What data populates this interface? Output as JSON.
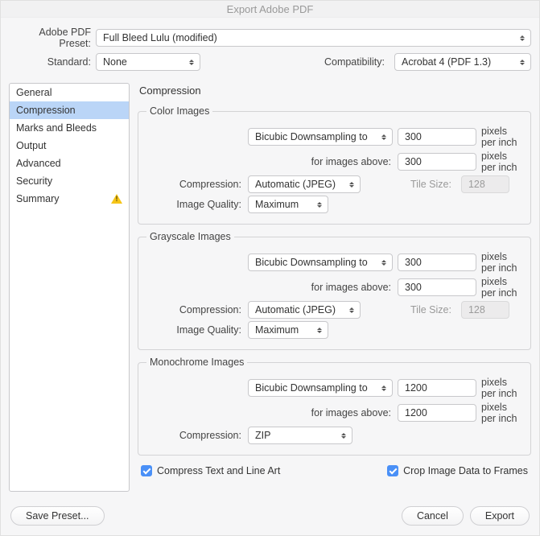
{
  "title": "Export Adobe PDF",
  "header": {
    "preset_label": "Adobe PDF Preset:",
    "preset_value": "Full Bleed Lulu (modified)",
    "standard_label": "Standard:",
    "standard_value": "None",
    "compat_label": "Compatibility:",
    "compat_value": "Acrobat 4 (PDF 1.3)"
  },
  "sidebar": {
    "items": [
      {
        "label": "General"
      },
      {
        "label": "Compression",
        "selected": true
      },
      {
        "label": "Marks and Bleeds"
      },
      {
        "label": "Output"
      },
      {
        "label": "Advanced"
      },
      {
        "label": "Security"
      },
      {
        "label": "Summary",
        "warn": true
      }
    ]
  },
  "panel": {
    "title": "Compression",
    "color": {
      "legend": "Color Images",
      "method": "Bicubic Downsampling to",
      "ppi": "300",
      "unit": "pixels per inch",
      "above_label": "for images above:",
      "above_ppi": "300",
      "compression_label": "Compression:",
      "compression_value": "Automatic (JPEG)",
      "tile_label": "Tile Size:",
      "tile_value": "128",
      "quality_label": "Image Quality:",
      "quality_value": "Maximum"
    },
    "gray": {
      "legend": "Grayscale Images",
      "method": "Bicubic Downsampling to",
      "ppi": "300",
      "unit": "pixels per inch",
      "above_label": "for images above:",
      "above_ppi": "300",
      "compression_label": "Compression:",
      "compression_value": "Automatic (JPEG)",
      "tile_label": "Tile Size:",
      "tile_value": "128",
      "quality_label": "Image Quality:",
      "quality_value": "Maximum"
    },
    "mono": {
      "legend": "Monochrome Images",
      "method": "Bicubic Downsampling to",
      "ppi": "1200",
      "unit": "pixels per inch",
      "above_label": "for images above:",
      "above_ppi": "1200",
      "compression_label": "Compression:",
      "compression_value": "ZIP"
    },
    "compress_text_label": "Compress Text and Line Art",
    "crop_label": "Crop Image Data to Frames"
  },
  "footer": {
    "save_preset": "Save Preset...",
    "cancel": "Cancel",
    "export": "Export"
  }
}
